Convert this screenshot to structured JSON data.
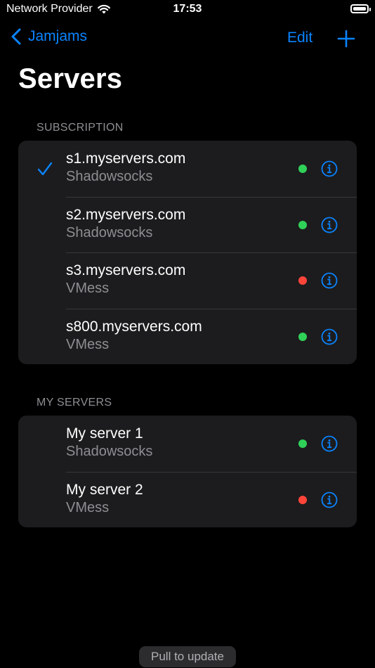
{
  "status_bar": {
    "carrier": "Network Provider",
    "time": "17:53"
  },
  "nav": {
    "back_label": "Jamjams",
    "edit_label": "Edit"
  },
  "page_title": "Servers",
  "colors": {
    "accent": "#0a84ff",
    "online": "#30d158",
    "offline": "#ff453a"
  },
  "sections": [
    {
      "header": "SUBSCRIPTION",
      "rows": [
        {
          "title": "s1.myservers.com",
          "subtitle": "Shadowsocks",
          "status": "online",
          "selected": true
        },
        {
          "title": "s2.myservers.com",
          "subtitle": "Shadowsocks",
          "status": "online",
          "selected": false
        },
        {
          "title": "s3.myservers.com",
          "subtitle": "VMess",
          "status": "offline",
          "selected": false
        },
        {
          "title": "s800.myservers.com",
          "subtitle": "VMess",
          "status": "online",
          "selected": false
        }
      ]
    },
    {
      "header": "MY SERVERS",
      "rows": [
        {
          "title": "My server 1",
          "subtitle": "Shadowsocks",
          "status": "online",
          "selected": false
        },
        {
          "title": "My server 2",
          "subtitle": "VMess",
          "status": "offline",
          "selected": false
        }
      ]
    }
  ],
  "toast": "Pull to update"
}
